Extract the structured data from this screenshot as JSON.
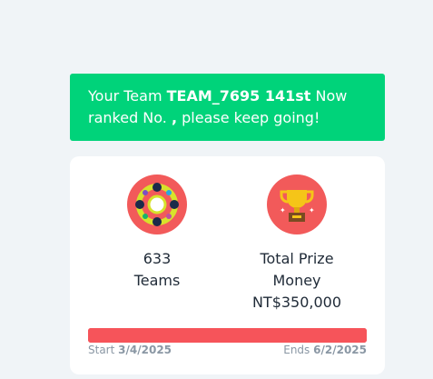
{
  "banner": {
    "prefix": "Your Team ",
    "team_name": "TEAM_7695 141st",
    "middle": " Now ranked No. ",
    "rank_punct": ",",
    "suffix": " please keep going!"
  },
  "stats": {
    "teams": {
      "value": "633",
      "label": "Teams",
      "icon": "teams-ring-icon"
    },
    "prize": {
      "label_line1": "Total Prize",
      "label_line2": "Money",
      "value": "NT$350,000",
      "icon": "trophy-icon"
    }
  },
  "timeline": {
    "start_label": "Start",
    "start_date": "3/4/2025",
    "end_label": "Ends",
    "end_date": "6/2/2025",
    "progress_fraction": 1.0
  },
  "colors": {
    "banner_bg": "#00d37a",
    "icon_bg": "#f25a5a",
    "progress": "#f6545a"
  }
}
